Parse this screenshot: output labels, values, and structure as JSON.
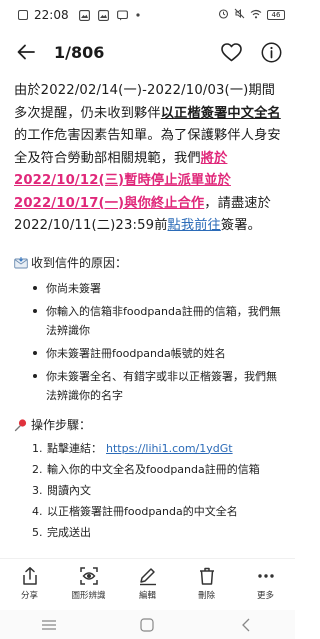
{
  "status": {
    "time": "22:08",
    "battery": "46"
  },
  "header": {
    "page_counter": "1/806",
    "icons": [
      "back-arrow-icon",
      "heart-icon",
      "info-icon"
    ]
  },
  "body": {
    "p1_a": "由於2022/02/14(一)-2022/10/03(一)期間多次提醒，仍未收到夥伴",
    "p1_b": "以正楷簽署中文全名",
    "p1_c": "的工作危害因素告知單。為了保護夥伴人身安全及符合勞動部相關規範，我們",
    "p1_d": "將於2022/10/12(三)暫時停止派單並於2022/10/17(一)與你終止合作",
    "p1_e": "，請盡速於2022/10/11(二)23:59前",
    "p1_link": "點我前往",
    "p1_f": "簽署。",
    "colors": {
      "highlight": "#e0287a",
      "link": "#2b6bb8"
    }
  },
  "reasons": {
    "title": "收到信件的原因：",
    "items": [
      "你尚未簽署",
      "你輸入的信箱非foodpanda註冊的信箱，我們無法辨識你",
      "你未簽署註冊foodpanda帳號的姓名",
      "你未簽署全名、有錯字或非以正楷簽署，我們無法辨識你的名字"
    ]
  },
  "steps": {
    "title": "操作步驟：",
    "items": [
      {
        "num": "1.",
        "text": "點擊連結：",
        "url": "https://lihi1.com/1ydGt"
      },
      {
        "num": "2.",
        "text": "輸入你的中文全名及foodpanda註冊的信箱"
      },
      {
        "num": "3.",
        "text": "閱讀內文"
      },
      {
        "num": "4.",
        "text": "以正楷簽署註冊foodpanda的中文全名"
      },
      {
        "num": "5.",
        "text": "完成送出"
      }
    ]
  },
  "toolbar": {
    "share": "分享",
    "image_recognition": "圖形辨識",
    "edit": "編輯",
    "delete": "刪除",
    "more": "更多"
  }
}
